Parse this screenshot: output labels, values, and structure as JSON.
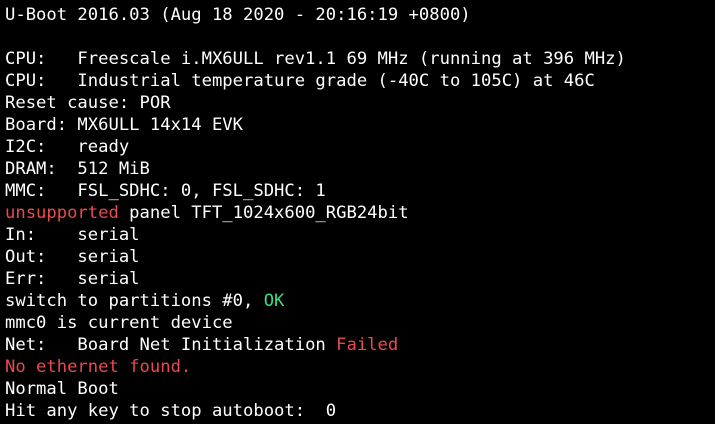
{
  "colors": {
    "background": "#000000",
    "text": "#ffffff",
    "error": "#e94b4b",
    "ok": "#3ddc84"
  },
  "terminal": {
    "banner": "U-Boot 2016.03 (Aug 18 2020 - 20:16:19 +0800)",
    "cpu1": "CPU:   Freescale i.MX6ULL rev1.1 69 MHz (running at 396 MHz)",
    "cpu2": "CPU:   Industrial temperature grade (-40C to 105C) at 46C",
    "reset": "Reset cause: POR",
    "board": "Board: MX6ULL 14x14 EVK",
    "i2c": "I2C:   ready",
    "dram": "DRAM:  512 MiB",
    "mmc": "MMC:   FSL_SDHC: 0, FSL_SDHC: 1",
    "panel_warn": "unsupported",
    "panel_rest": " panel TFT_1024x600_RGB24bit",
    "in": "In:    serial",
    "out": "Out:   serial",
    "err": "Err:   serial",
    "switch_text": "switch to partitions #0, ",
    "switch_ok": "OK",
    "mmc_current": "mmc0 is current device",
    "net_text": "Net:   Board Net Initialization ",
    "net_failed": "Failed",
    "no_ethernet": "No ethernet found.",
    "normal_boot": "Normal Boot",
    "autoboot": "Hit any key to stop autoboot:  0"
  }
}
